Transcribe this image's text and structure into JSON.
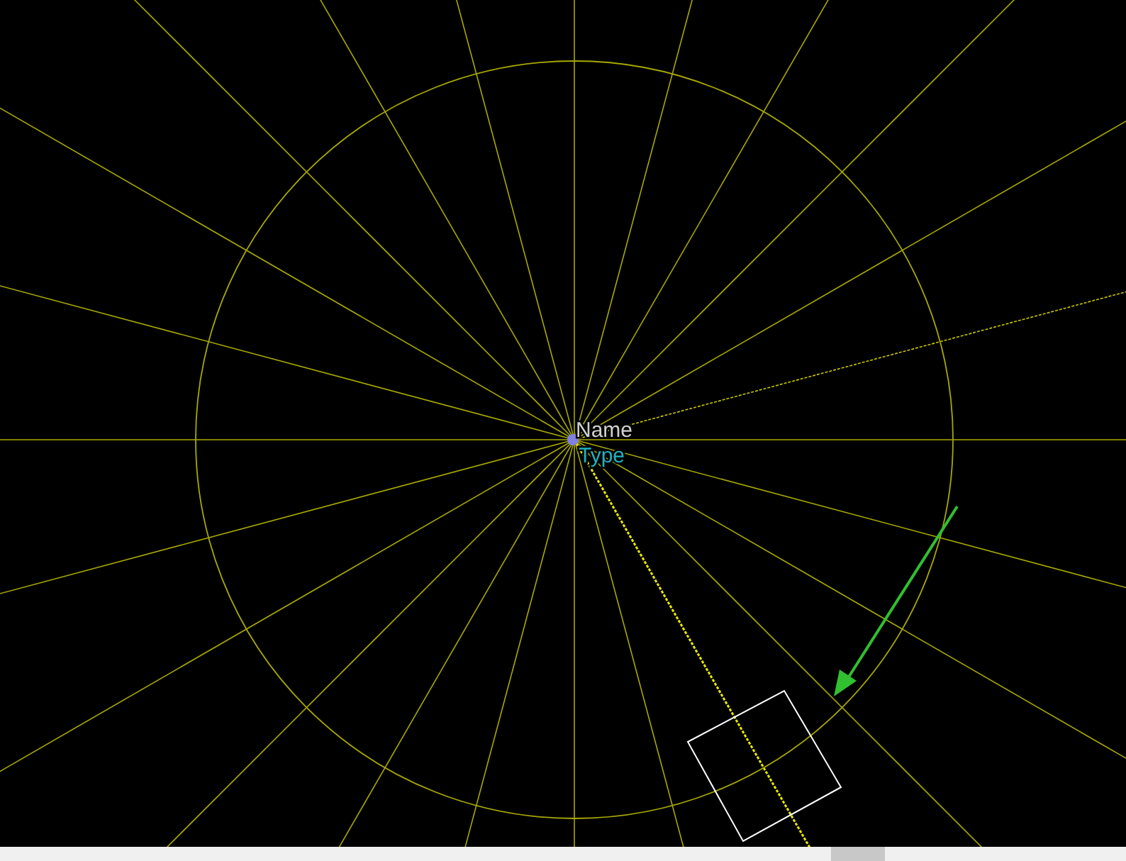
{
  "component": {
    "name": "Name",
    "type": "Type"
  }
}
